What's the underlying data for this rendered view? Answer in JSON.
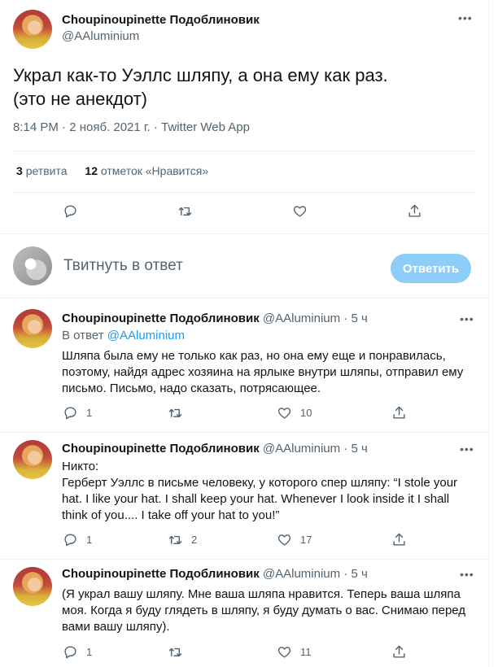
{
  "main_tweet": {
    "author_name": "Choupinoupinette Подоблиновик",
    "author_handle": "@AAluminium",
    "text_line1": "Украл как-то Уэллс шляпу, а она ему как раз.",
    "text_line2": "(это не анекдот)",
    "meta": "8:14 PM · 2 нояб. 2021 г. · Twitter Web App",
    "retweets_count": "3",
    "retweets_label": "ретвита",
    "likes_count": "12",
    "likes_label": "отметок «Нравится»"
  },
  "reply_box": {
    "placeholder": "Твитнуть в ответ",
    "button_label": "Ответить"
  },
  "replies": [
    {
      "author_name": "Choupinoupinette Подоблиновик",
      "author_handle": "@AAluminium",
      "time": "· 5 ч",
      "replying_prefix": "В ответ",
      "replying_handle": "@AAluminium",
      "lines": [
        "Шляпа была ему не только как раз, но она ему еще и понравилась,",
        "поэтому, найдя адрес хозяина на ярлыке внутри шляпы, отправил ему",
        "письмо. Письмо, надо сказать, потрясающее."
      ],
      "reply_count": "1",
      "retweet_count": "",
      "like_count": "10"
    },
    {
      "author_name": "Choupinoupinette Подоблиновик",
      "author_handle": "@AAluminium",
      "time": "· 5 ч",
      "lines": [
        "Никто:",
        "Герберт Уэллс в письме человеку, у которого спер шляпу: “I stole your",
        "hat. I like your hat. I shall keep your hat. Whenever I look inside it I shall",
        "think of you.... I take off your hat to you!”"
      ],
      "reply_count": "1",
      "retweet_count": "2",
      "like_count": "17"
    },
    {
      "author_name": "Choupinoupinette Подоблиновик",
      "author_handle": "@AAluminium",
      "time": "· 5 ч",
      "lines": [
        "(Я украл вашу шляпу. Мне ваша шляпа нравится. Теперь ваша шляпа",
        "моя. Когда я буду глядеть в шляпу, я буду думать о вас. Снимаю перед",
        "вами вашу шляпу)."
      ],
      "reply_count": "1",
      "retweet_count": "",
      "like_count": "11"
    }
  ],
  "icons": {
    "reply": "reply-icon",
    "retweet": "retweet-icon",
    "like": "heart-icon",
    "share": "share-icon",
    "more": "more-icon"
  },
  "colors": {
    "accent": "#1d9bf0",
    "button_disabled": "#8ecdf8",
    "secondary_text": "#536471"
  }
}
